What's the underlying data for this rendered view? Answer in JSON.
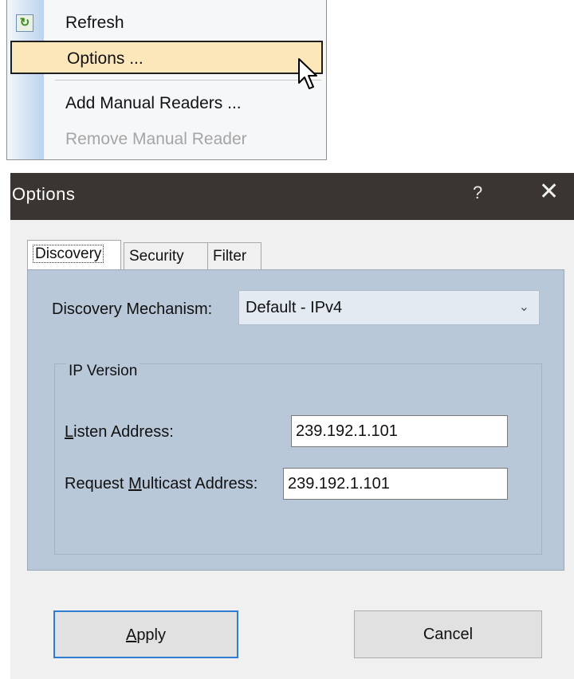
{
  "context_menu": {
    "items": [
      {
        "label": "Refresh",
        "icon": "refresh-icon",
        "enabled": true
      },
      {
        "label": "Options ...",
        "enabled": true,
        "highlighted": true
      },
      {
        "label": "Add Manual Readers ...",
        "enabled": true
      },
      {
        "label": "Remove Manual Reader",
        "enabled": false
      }
    ]
  },
  "dialog": {
    "title": "Options",
    "help_glyph": "?",
    "close_glyph": "✕",
    "tabs": [
      {
        "label": "Discovery",
        "selected": true
      },
      {
        "label": "Security",
        "selected": false
      },
      {
        "label": "Filter",
        "selected": false
      }
    ],
    "discovery_mechanism": {
      "label": "Discovery Mechanism:",
      "value": "Default - IPv4"
    },
    "ip_group": {
      "title": "IP Version",
      "listen_label_accel": "L",
      "listen_label_rest": "isten Address:",
      "listen_value": "239.192.1.101",
      "multicast_label_pre": "Request ",
      "multicast_label_accel": "M",
      "multicast_label_rest": "ulticast Address:",
      "multicast_value": "239.192.1.101"
    },
    "buttons": {
      "apply_accel": "A",
      "apply_rest": "pply",
      "cancel": "Cancel"
    }
  },
  "colors": {
    "title_bar": "#3a3530",
    "menu_highlight": "#fbe7b9",
    "tab_panel": "#b9c8d9",
    "default_button_border": "#2f7dd0"
  }
}
